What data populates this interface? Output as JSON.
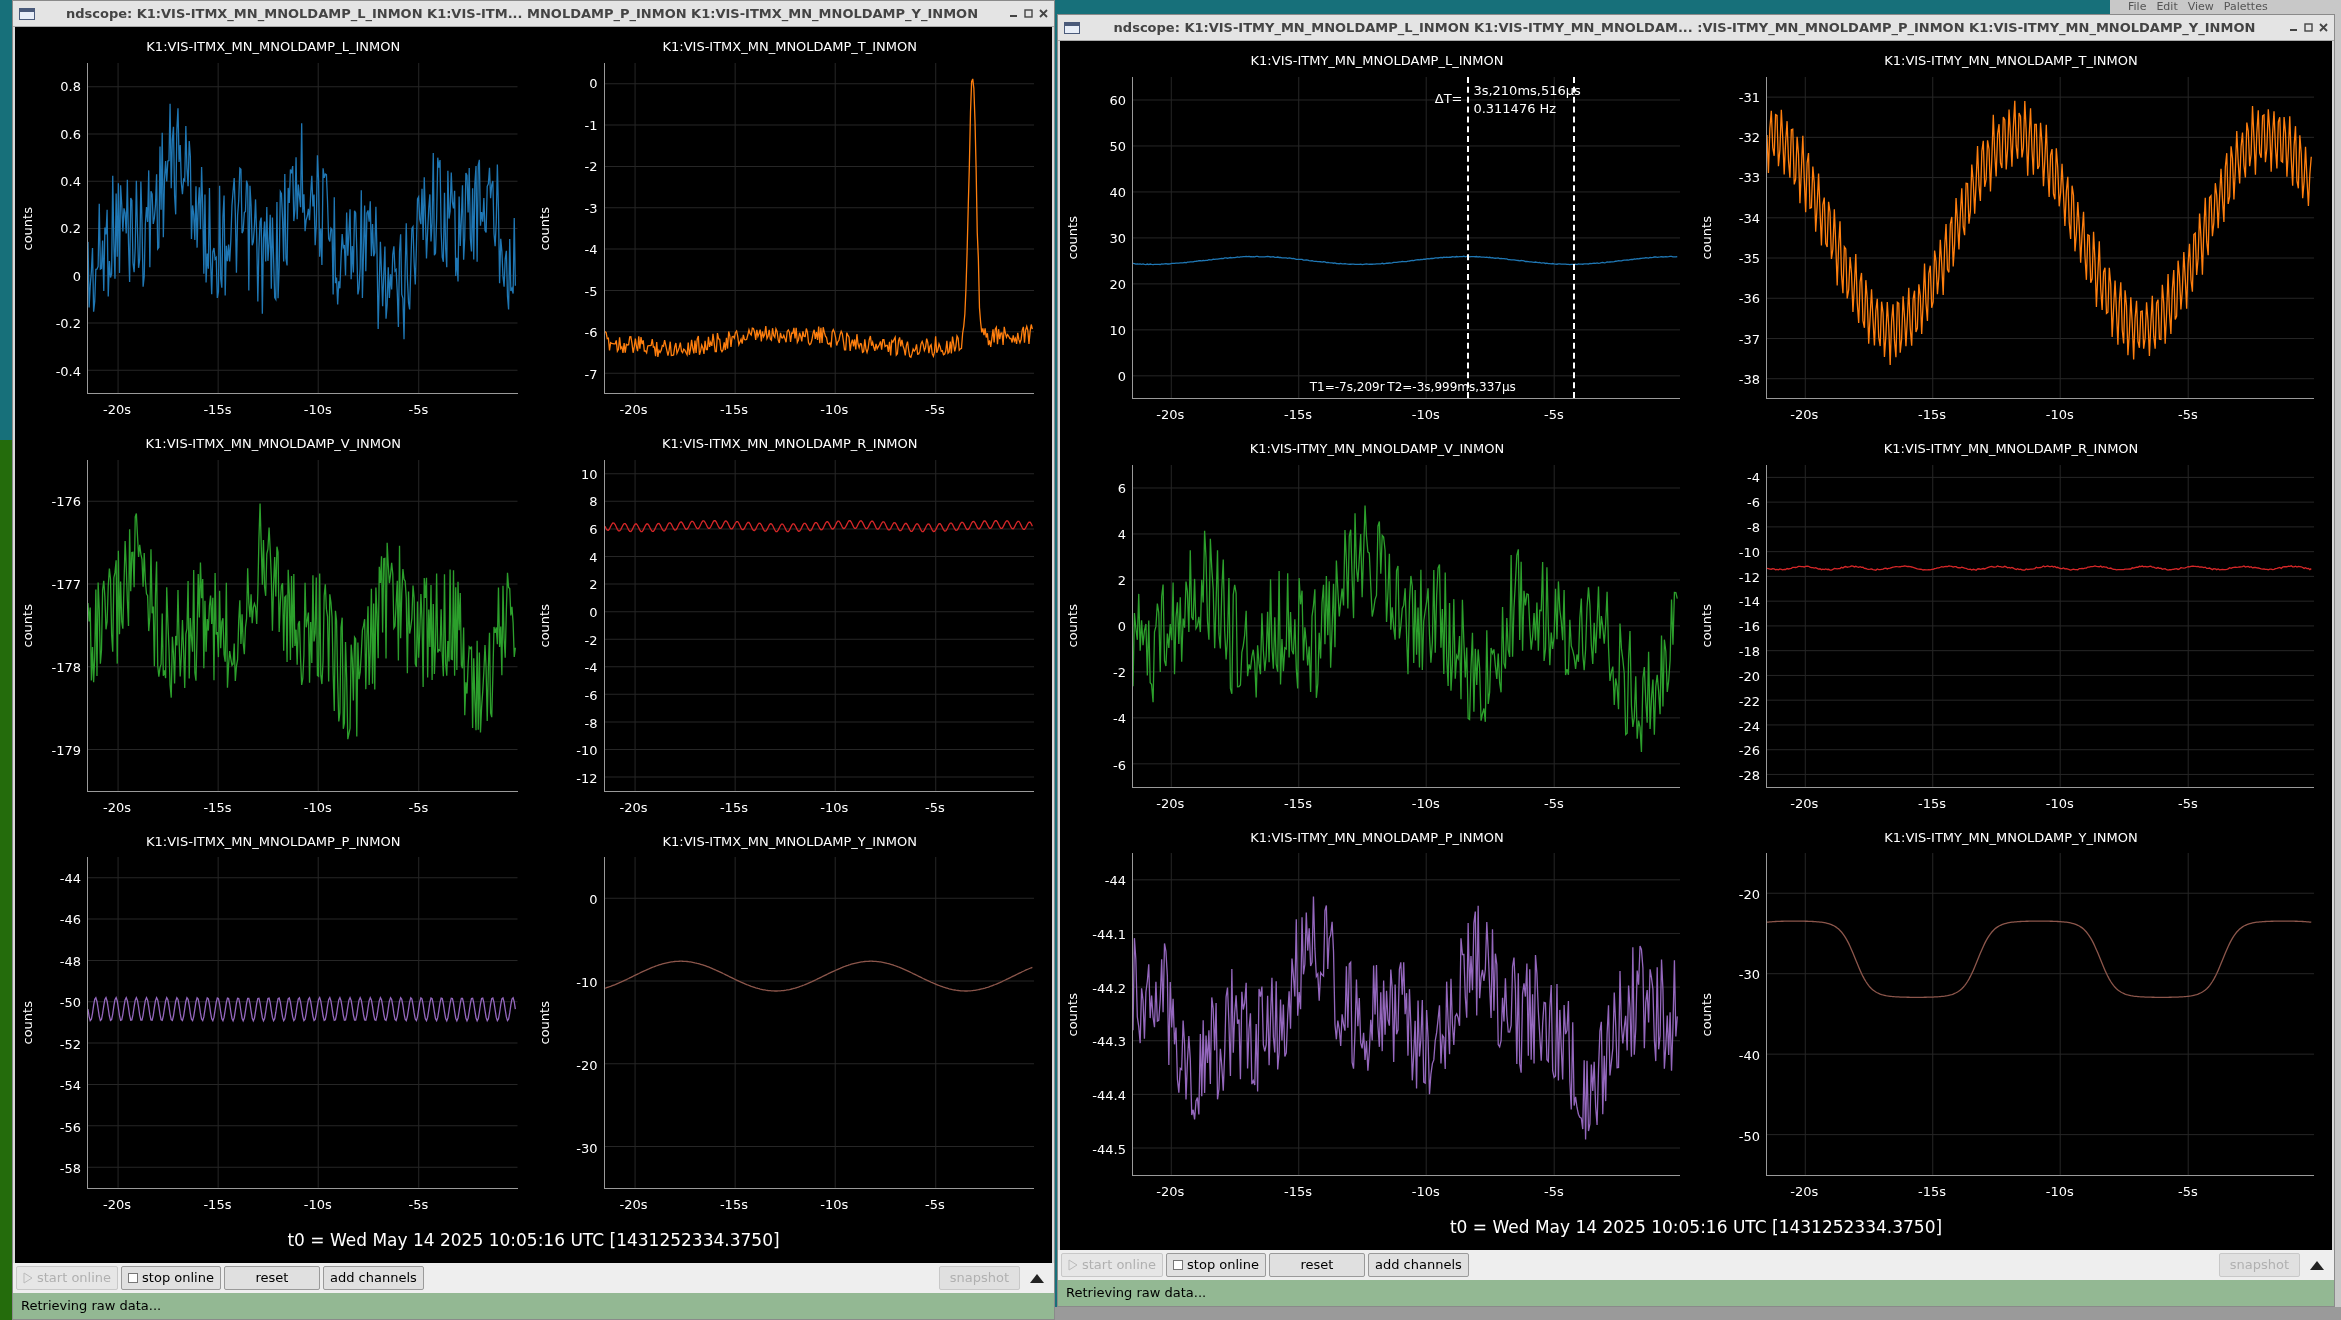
{
  "desktop_menu": [
    "File",
    "Edit",
    "View",
    "Palettes"
  ],
  "windows": [
    {
      "title": "ndscope: K1:VIS-ITMX_MN_MNOLDAMP_L_INMON K1:VIS-ITM... MNOLDAMP_P_INMON K1:VIS-ITMX_MN_MNOLDAMP_Y_INMON",
      "plots": [
        {
          "title": "K1:VIS-ITMX_MN_MNOLDAMP_L_INMON",
          "ylabel": "counts",
          "yticks": [
            "0.8",
            "0.6",
            "0.4",
            "0.2",
            "0",
            "-0.2",
            "-0.4"
          ],
          "xticks": [
            "-20s",
            "-15s",
            "-10s",
            "-5s"
          ],
          "trace": {
            "color": "#1f77b4",
            "kind": "noise"
          }
        },
        {
          "title": "K1:VIS-ITMX_MN_MNOLDAMP_T_INMON",
          "ylabel": "counts",
          "yticks": [
            "0",
            "-1",
            "-2",
            "-3",
            "-4",
            "-5",
            "-6",
            "-7"
          ],
          "xticks": [
            "-20s",
            "-15s",
            "-10s",
            "-5s"
          ],
          "trace": {
            "color": "#ff7f0e",
            "kind": "spike"
          }
        },
        {
          "title": "K1:VIS-ITMX_MN_MNOLDAMP_V_INMON",
          "ylabel": "counts",
          "yticks": [
            "-176",
            "-177",
            "-178",
            "-179"
          ],
          "xticks": [
            "-20s",
            "-15s",
            "-10s",
            "-5s"
          ],
          "trace": {
            "color": "#2ca02c",
            "kind": "noise"
          }
        },
        {
          "title": "K1:VIS-ITMX_MN_MNOLDAMP_R_INMON",
          "ylabel": "counts",
          "yticks": [
            "10",
            "8",
            "6",
            "4",
            "2",
            "0",
            "-2",
            "-4",
            "-6",
            "-8",
            "-10",
            "-12"
          ],
          "xticks": [
            "-20s",
            "-15s",
            "-10s",
            "-5s"
          ],
          "trace": {
            "color": "#d62728",
            "kind": "ripple"
          }
        },
        {
          "title": "K1:VIS-ITMX_MN_MNOLDAMP_P_INMON",
          "ylabel": "counts",
          "yticks": [
            "-44",
            "-46",
            "-48",
            "-50",
            "-52",
            "-54",
            "-56",
            "-58"
          ],
          "xticks": [
            "-20s",
            "-15s",
            "-10s",
            "-5s"
          ],
          "trace": {
            "color": "#9467bd",
            "kind": "sine"
          }
        },
        {
          "title": "K1:VIS-ITMX_MN_MNOLDAMP_Y_INMON",
          "ylabel": "counts",
          "yticks": [
            "0",
            "-10",
            "-20",
            "-30"
          ],
          "xticks": [
            "-20s",
            "-15s",
            "-10s",
            "-5s"
          ],
          "trace": {
            "color": "#8c564b",
            "kind": "slow-wave"
          }
        }
      ],
      "t0": "t0 = Wed May 14 2025 10:05:16 UTC [1431252334.3750]",
      "buttons": [
        {
          "label": "start online",
          "disabled": true
        },
        {
          "label": "stop online",
          "disabled": false
        },
        {
          "label": "reset",
          "disabled": false
        },
        {
          "label": "add channels",
          "disabled": false
        }
      ],
      "snapshot": {
        "label": "snapshot",
        "disabled": true
      },
      "status": "Retrieving raw data..."
    },
    {
      "title": "ndscope: K1:VIS-ITMY_MN_MNOLDAMP_L_INMON K1:VIS-ITMY_MN_MNOLDAM... :VIS-ITMY_MN_MNOLDAMP_P_INMON K1:VIS-ITMY_MN_MNOLDAMP_Y_INMON",
      "plots": [
        {
          "title": "K1:VIS-ITMY_MN_MNOLDAMP_L_INMON",
          "ylabel": "counts",
          "yticks": [
            "60",
            "50",
            "40",
            "30",
            "20",
            "10",
            "0"
          ],
          "xticks": [
            "-20s",
            "-15s",
            "-10s",
            "-5s"
          ],
          "trace": {
            "color": "#1f77b4",
            "kind": "flat"
          },
          "cursors": {
            "delta_label": "ΔT=",
            "delta": "3s,210ms,516µs",
            "frequency": "0.311476 Hz",
            "t1": "T1=-7s,209r",
            "t2": "T2=-3s,999ms,337µs"
          }
        },
        {
          "title": "K1:VIS-ITMY_MN_MNOLDAMP_T_INMON",
          "ylabel": "counts",
          "yticks": [
            "-31",
            "-32",
            "-33",
            "-34",
            "-35",
            "-36",
            "-37",
            "-38"
          ],
          "xticks": [
            "-20s",
            "-15s",
            "-10s",
            "-5s"
          ],
          "trace": {
            "color": "#ff7f0e",
            "kind": "jagged-wave"
          }
        },
        {
          "title": "K1:VIS-ITMY_MN_MNOLDAMP_V_INMON",
          "ylabel": "counts",
          "yticks": [
            "6",
            "4",
            "2",
            "0",
            "-2",
            "-4",
            "-6"
          ],
          "xticks": [
            "-20s",
            "-15s",
            "-10s",
            "-5s"
          ],
          "trace": {
            "color": "#2ca02c",
            "kind": "noise"
          }
        },
        {
          "title": "K1:VIS-ITMY_MN_MNOLDAMP_R_INMON",
          "ylabel": "counts",
          "yticks": [
            "-4",
            "-6",
            "-8",
            "-10",
            "-12",
            "-14",
            "-16",
            "-18",
            "-20",
            "-22",
            "-24",
            "-26",
            "-28"
          ],
          "xticks": [
            "-20s",
            "-15s",
            "-10s",
            "-5s"
          ],
          "trace": {
            "color": "#d62728",
            "kind": "flat-noise"
          }
        },
        {
          "title": "K1:VIS-ITMY_MN_MNOLDAMP_P_INMON",
          "ylabel": "counts",
          "yticks": [
            "-44",
            "-44.1",
            "-44.2",
            "-44.3",
            "-44.4",
            "-44.5"
          ],
          "xticks": [
            "-20s",
            "-15s",
            "-10s",
            "-5s"
          ],
          "trace": {
            "color": "#9467bd",
            "kind": "noise"
          }
        },
        {
          "title": "K1:VIS-ITMY_MN_MNOLDAMP_Y_INMON",
          "ylabel": "counts",
          "yticks": [
            "-20",
            "-30",
            "-40",
            "-50"
          ],
          "xticks": [
            "-20s",
            "-15s",
            "-10s",
            "-5s"
          ],
          "trace": {
            "color": "#8c564b",
            "kind": "plateau-wave"
          }
        }
      ],
      "t0": "t0 = Wed May 14 2025 10:05:16 UTC [1431252334.3750]",
      "buttons": [
        {
          "label": "start online",
          "disabled": true
        },
        {
          "label": "stop online",
          "disabled": false
        },
        {
          "label": "reset",
          "disabled": false
        },
        {
          "label": "add channels",
          "disabled": false
        }
      ],
      "snapshot": {
        "label": "snapshot",
        "disabled": true
      },
      "status": "Retrieving raw data..."
    }
  ]
}
